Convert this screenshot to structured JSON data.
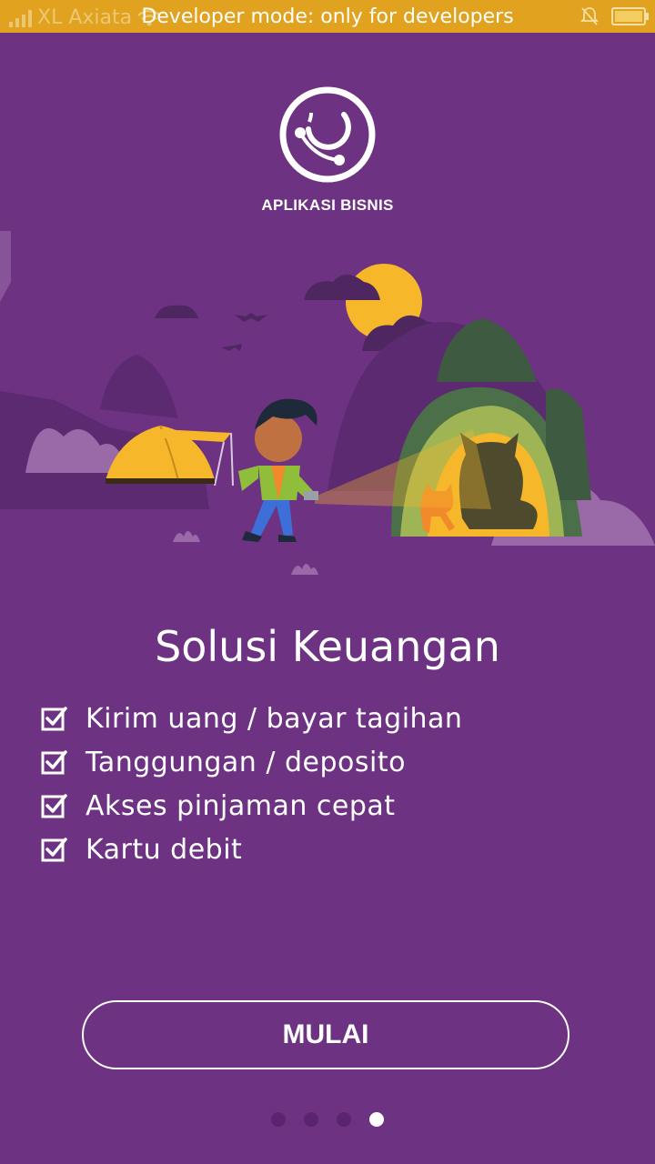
{
  "status_bar": {
    "carrier": "XL Axiata",
    "developer_banner": "Developer mode: only for developers",
    "battery_level": 1.0
  },
  "brand": {
    "name": "APLIKASI BISNIS"
  },
  "headline": "Solusi Keuangan",
  "features": [
    "Kirim uang / bayar tagihan",
    "Tanggungan / deposito",
    "Akses pinjaman cepat",
    "Kartu debit"
  ],
  "cta_label": "MULAI",
  "pagination": {
    "total": 4,
    "current": 4
  },
  "colors": {
    "background": "#6d3282",
    "status_bar": "#e0a21f",
    "accent": "#f6b82a",
    "text": "#ffffff"
  },
  "icons": [
    "signal-icon",
    "wifi-icon",
    "notification-off-icon",
    "battery-icon",
    "check-box-icon",
    "brand-logo-icon"
  ]
}
